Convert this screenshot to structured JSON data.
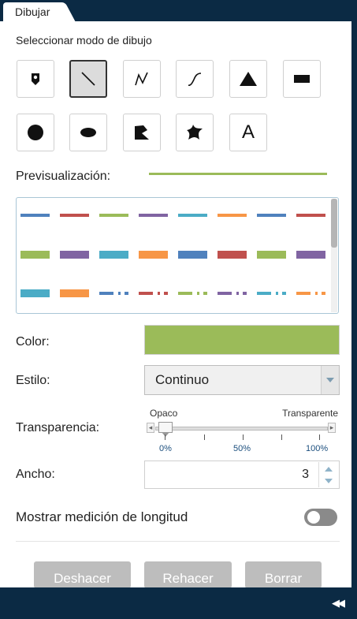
{
  "tab": {
    "label": "Dibujar"
  },
  "mode": {
    "title": "Seleccionar modo de dibujo",
    "tools": [
      {
        "name": "point",
        "icon": "map-pin-icon"
      },
      {
        "name": "line",
        "icon": "line-icon",
        "selected": true
      },
      {
        "name": "polyline",
        "icon": "polyline-icon"
      },
      {
        "name": "freehand-line",
        "icon": "freehand-line-icon"
      },
      {
        "name": "triangle",
        "icon": "triangle-icon"
      },
      {
        "name": "rectangle",
        "icon": "rectangle-icon"
      },
      {
        "name": "circle",
        "icon": "circle-icon"
      },
      {
        "name": "ellipse",
        "icon": "ellipse-icon"
      },
      {
        "name": "polygon",
        "icon": "polygon-icon"
      },
      {
        "name": "freehand-polygon",
        "icon": "freehand-polygon-icon"
      },
      {
        "name": "text",
        "icon": "text-icon",
        "glyph": "A"
      }
    ]
  },
  "preview": {
    "label": "Previsualización:",
    "color": "#9bbb59"
  },
  "style_palette": {
    "rows": [
      [
        "#4f81bd",
        "#c0504d",
        "#9bbb59",
        "#8064a2",
        "#4bacc6",
        "#f79646",
        "#4f81bd",
        "#c0504d"
      ],
      [
        "#9bbb59",
        "#8064a2",
        "#4bacc6",
        "#f79646",
        "#4f81bd",
        "#c0504d",
        "#9bbb59",
        "#8064a2"
      ],
      [
        "#4bacc6",
        "#f79646",
        "#4f81bd",
        "#c0504d",
        "#9bbb59",
        "#8064a2",
        "#4bacc6",
        "#f79646"
      ]
    ]
  },
  "color": {
    "label": "Color:",
    "value": "#9bbb59"
  },
  "style": {
    "label": "Estilo:",
    "value": "Continuo"
  },
  "transparency": {
    "label": "Transparencia:",
    "min_label": "Opaco",
    "max_label": "Transparente",
    "ticks": [
      "0%",
      "50%",
      "100%"
    ],
    "value": 0
  },
  "width": {
    "label": "Ancho:",
    "value": "3"
  },
  "measure": {
    "label": "Mostrar medición de longitud",
    "enabled": false
  },
  "buttons": {
    "undo": "Deshacer",
    "redo": "Rehacer",
    "clear": "Borrar"
  }
}
